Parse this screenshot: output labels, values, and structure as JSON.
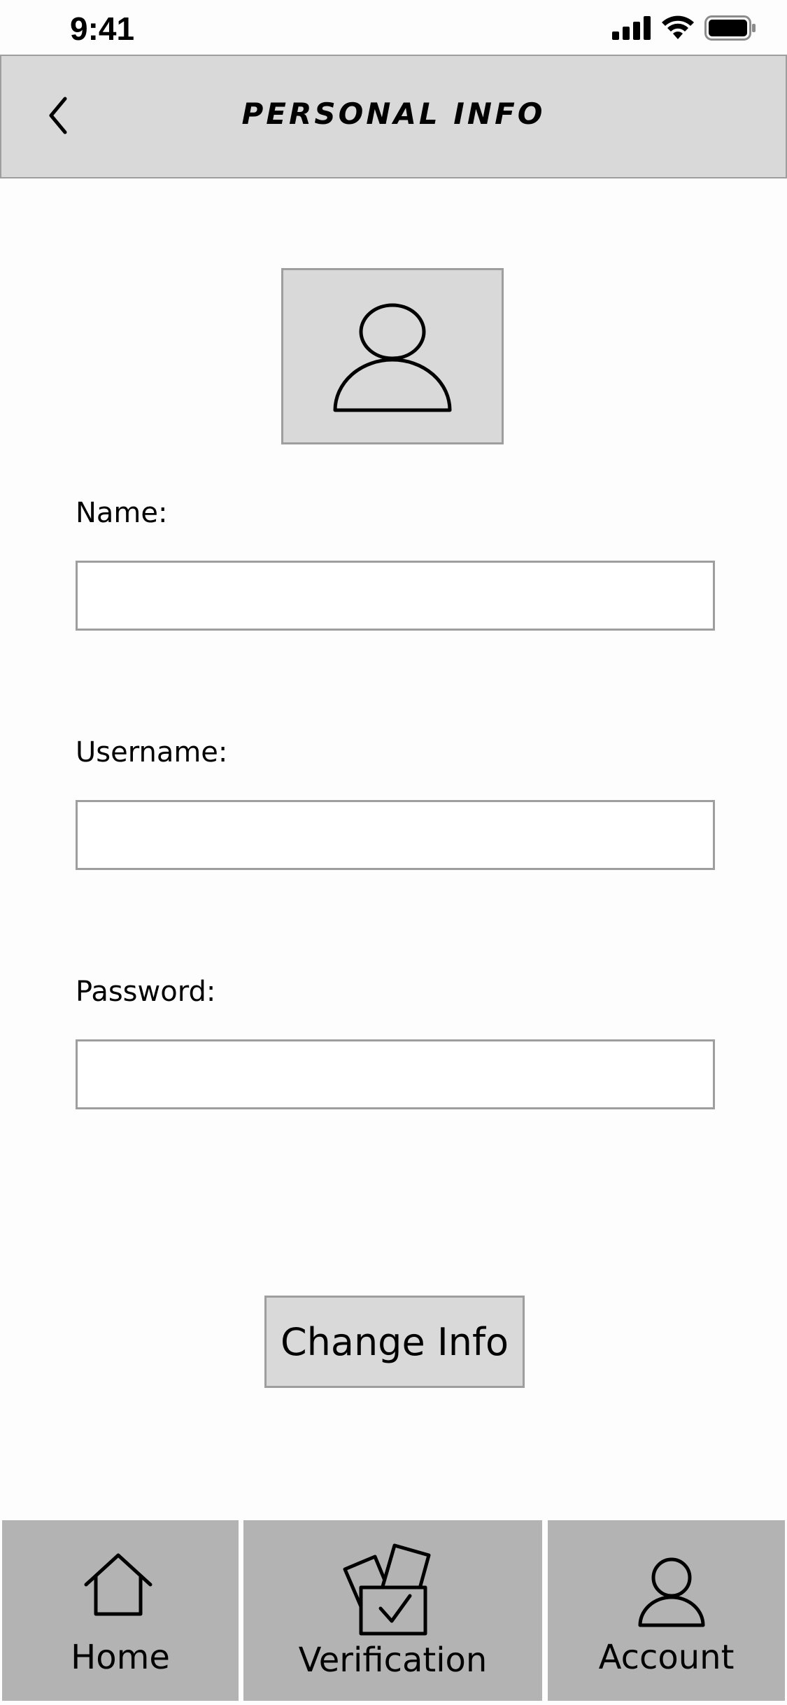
{
  "status_bar": {
    "time": "9:41",
    "icons": [
      "cellular-signal-icon",
      "wifi-icon",
      "battery-icon"
    ]
  },
  "header": {
    "title": "Personal Info",
    "back_icon": "chevron-left-icon"
  },
  "avatar": {
    "icon": "user-profile-icon"
  },
  "form": {
    "name_label": "Name:",
    "name_value": "",
    "username_label": "Username:",
    "username_value": "",
    "password_label": "Password:",
    "password_value": ""
  },
  "actions": {
    "change_info_label": "Change Info"
  },
  "tab_bar": {
    "home_label": "Home",
    "home_icon": "home-icon",
    "verification_label": "Verification",
    "verification_icon": "verification-check-icon",
    "account_label": "Account",
    "account_icon": "account-icon"
  },
  "colors": {
    "header_bg": "#d9d9d9",
    "border": "#9e9e9e",
    "tab_bg": "#b3b3b3",
    "page_bg": "#fdfdfd"
  }
}
